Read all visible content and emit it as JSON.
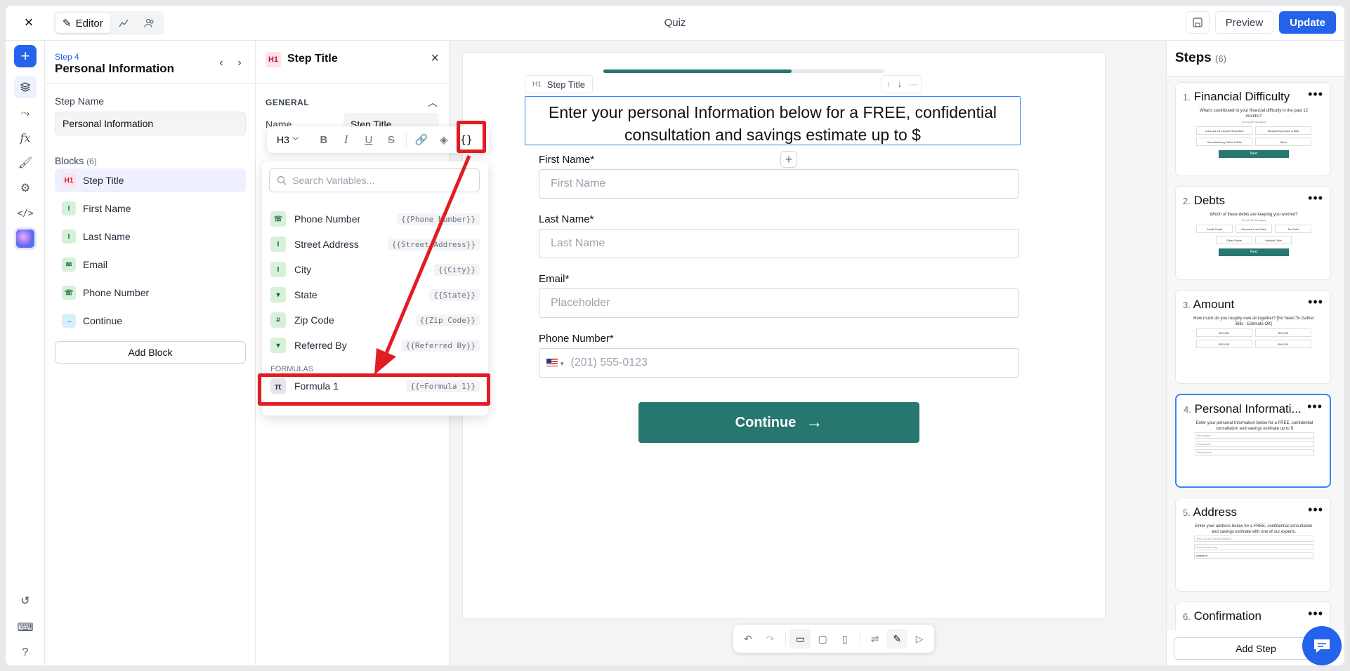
{
  "topbar": {
    "title": "Quiz",
    "modes": [
      {
        "label": "Editor",
        "icon": "magic-wand-icon"
      },
      {
        "label": "",
        "icon": "chart-icon"
      },
      {
        "label": "",
        "icon": "users-icon"
      }
    ],
    "preview_label": "Preview",
    "update_label": "Update"
  },
  "steps_panel": {
    "step_number": "Step 4",
    "step_title": "Personal Information",
    "step_name_label": "Step Name",
    "step_name_value": "Personal Information",
    "blocks_label": "Blocks",
    "blocks_count": "(6)",
    "blocks": [
      {
        "label": "Step Title",
        "icon": "H1",
        "kind": "h1"
      },
      {
        "label": "First Name",
        "icon": "I",
        "kind": "green"
      },
      {
        "label": "Last Name",
        "icon": "I",
        "kind": "green"
      },
      {
        "label": "Email",
        "icon": "✉",
        "kind": "green"
      },
      {
        "label": "Phone Number",
        "icon": "☏",
        "kind": "green"
      },
      {
        "label": "Continue",
        "icon": "→",
        "kind": "blue"
      }
    ],
    "add_block_label": "Add Block"
  },
  "settings_panel": {
    "icon": "H1",
    "title": "Step Title",
    "general_label": "GENERAL",
    "name_label": "Name",
    "name_value": "Step Title"
  },
  "format_toolbar": {
    "heading_level": "H3"
  },
  "variables": {
    "search_placeholder": "Search Variables...",
    "items": [
      {
        "label": "Phone Number",
        "token": "{{Phone Number}}",
        "icon": "☏"
      },
      {
        "label": "Street Address",
        "token": "{{Street Address}}",
        "icon": "I"
      },
      {
        "label": "City",
        "token": "{{City}}",
        "icon": "I"
      },
      {
        "label": "State",
        "token": "{{State}}",
        "icon": "▾"
      },
      {
        "label": "Zip Code",
        "token": "{{Zip Code}}",
        "icon": "#"
      },
      {
        "label": "Referred By",
        "token": "{{Referred By}}",
        "icon": "▾"
      }
    ],
    "formulas_label": "FORMULAS",
    "formulas": [
      {
        "label": "Formula 1",
        "token": "{{=Formula 1}}",
        "icon": "π"
      }
    ]
  },
  "canvas": {
    "progress": 0.67,
    "block_tag_level": "H1",
    "block_tag_label": "Step Title",
    "heading": "Enter your personal Information below for a FREE, confidential consultation and savings estimate up to $",
    "fields": [
      {
        "label": "First Name*",
        "placeholder": "First Name"
      },
      {
        "label": "Last Name*",
        "placeholder": "Last Name"
      },
      {
        "label": "Email*",
        "placeholder": "Placeholder"
      }
    ],
    "phone_label": "Phone Number*",
    "phone_placeholder": "(201) 555-0123",
    "continue_label": "Continue"
  },
  "right_panel": {
    "title": "Steps",
    "count": "(6)",
    "steps": [
      {
        "num": "1.",
        "title": "Financial Difficulty",
        "preview": "What's contributed to your financial difficulty in the past 12 months?",
        "sub": "Check all that apply",
        "options": [
          "Job Loss Or Income Reduction",
          "Medical Expenses & Bills",
          "Overwhelming Debts & Bills",
          "Other"
        ],
        "button": "Next"
      },
      {
        "num": "2.",
        "title": "Debts",
        "preview": "Which of these debts are keeping you worried?",
        "sub": "Check all that apply",
        "options": [
          "Credit Cards",
          "Personal Loan Debt",
          "Tax Debt",
          "Other Debts",
          "Medical Debt"
        ],
        "button": "Next"
      },
      {
        "num": "3.",
        "title": "Amount",
        "preview": "How much do you roughly owe all together? [No Need To Gather Bills - Estimate OK]",
        "sub": "",
        "options": [
          "$10,000",
          "$20,000",
          "$30,000",
          "$40,000"
        ],
        "button": ""
      },
      {
        "num": "4.",
        "title": "Personal Informati...",
        "preview": "Enter your personal Information below for a FREE, confidential consultation and savings estimate up to $",
        "fields": [
          "First Name",
          "Last Name",
          "Placeholder"
        ]
      },
      {
        "num": "5.",
        "title": "Address",
        "preview": "Enter your address below for a FREE, confidential consultation and savings estimate with one of our experts.",
        "fields": [
          "Your Current Street Address",
          "Your Current City",
          "Alabama"
        ]
      },
      {
        "num": "6.",
        "title": "Confirmation"
      }
    ],
    "add_step_label": "Add Step"
  }
}
